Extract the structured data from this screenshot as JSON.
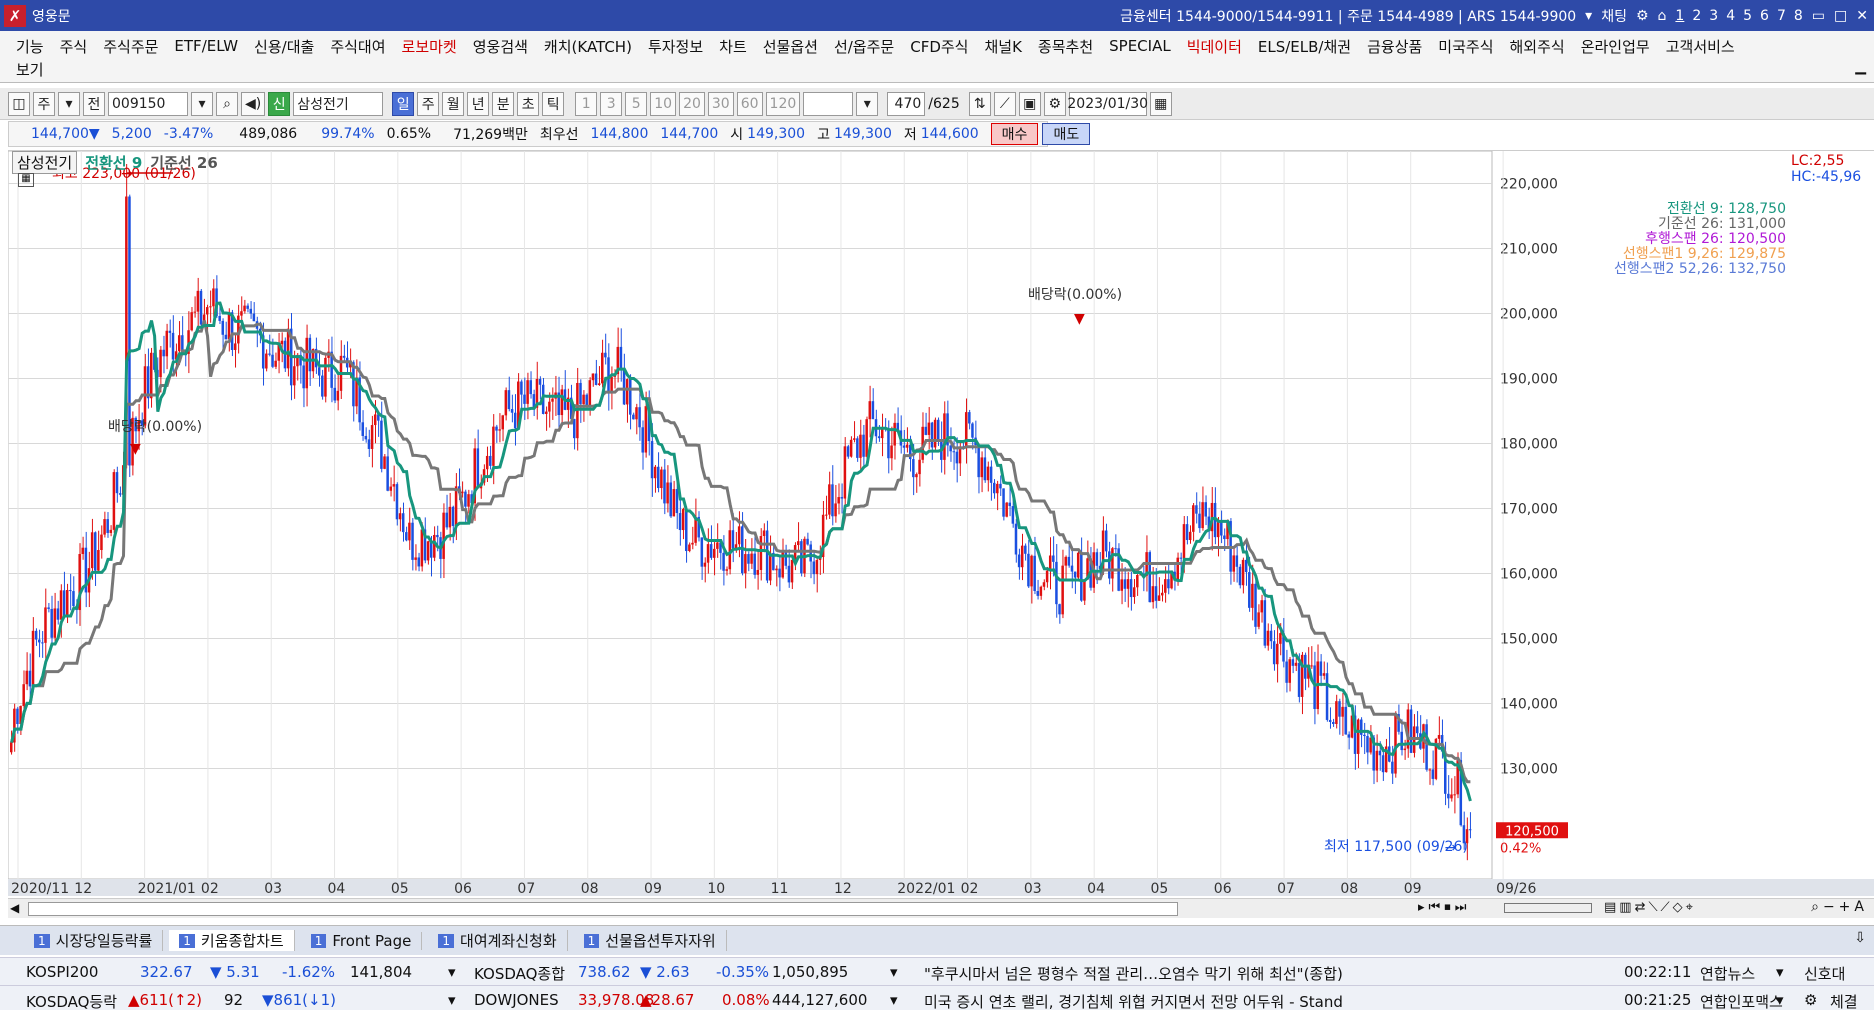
{
  "titlebar": {
    "app_name": "영웅문",
    "info": "금융센터 1544-9000/1544-9911 | 주문 1544-4989 | ARS 1544-9900",
    "chat": "채팅",
    "screens": [
      "1",
      "2",
      "3",
      "4",
      "5",
      "6",
      "7",
      "8"
    ]
  },
  "menu": {
    "items": [
      "기능",
      "주식",
      "주식주문",
      "ETF/ELW",
      "신용/대출",
      "주식대여",
      "로보마켓",
      "영웅검색",
      "캐치(KATCH)",
      "투자정보",
      "차트",
      "선물옵션",
      "선/옵주문",
      "CFD주식",
      "채널K",
      "종목추천",
      "SPECIAL",
      "빅데이터",
      "ELS/ELB/채권",
      "금융상품",
      "미국주식",
      "해외주식",
      "온라인업무",
      "고객서비스"
    ],
    "red_items": [
      "로보마켓",
      "빅데이터"
    ],
    "second_line": "보기"
  },
  "toolbar": {
    "mode1": "주",
    "mode2": "전",
    "code": "009150",
    "credit_badge": "신",
    "name": "삼성전기",
    "periods": [
      "일",
      "주",
      "월",
      "년",
      "분",
      "초",
      "틱"
    ],
    "active_period": "일",
    "intervals": [
      "1",
      "3",
      "5",
      "10",
      "20",
      "30",
      "60",
      "120"
    ],
    "count": "470",
    "total": "/625",
    "date": "2023/01/30"
  },
  "quote": {
    "price": "144,700▼",
    "change": "5,200",
    "rate": "-3.47%",
    "volume": "489,086",
    "vol_ratio": "99.74%",
    "turnover_rate": "0.65%",
    "amount": "71,269백만",
    "best_label": "최우선",
    "best_ask": "144,800",
    "best_bid": "144,700",
    "open_label": "시",
    "open": "149,300",
    "high_label": "고",
    "high": "149,300",
    "low_label": "저",
    "low": "144,600",
    "buy": "매수",
    "sell": "매도"
  },
  "chart": {
    "stock": "삼성전기",
    "ind1": "전환선 9",
    "ind2": "기준선 26",
    "max_label": "최고 223,000 (01/26)",
    "min_label": "최저 117,500 (09/26)",
    "dividend1": "배당락(0.00%)",
    "dividend2": "배당락(0.00%)",
    "lc": "LC:2,55",
    "hc": "HC:-45,96",
    "right_legend": [
      {
        "text": "전환선 9: 128,750",
        "color": "#17967e"
      },
      {
        "text": "기준선 26: 131,000",
        "color": "#666666"
      },
      {
        "text": "후행스팬 26: 120,500",
        "color": "#b01ad6"
      },
      {
        "text": "선행스팬1 9,26: 129,875",
        "color": "#f0a050"
      },
      {
        "text": "선행스팬2 52,26: 132,750",
        "color": "#5a7ad6"
      }
    ],
    "last_price": "120,500",
    "last_rate": "0.42%",
    "y_ticks": [
      "220,000",
      "210,000",
      "200,000",
      "190,000",
      "180,000",
      "170,000",
      "160,000",
      "150,000",
      "140,000",
      "130,000"
    ],
    "x_ticks": [
      "2020/11",
      "12",
      "2021/01",
      "02",
      "03",
      "04",
      "05",
      "06",
      "07",
      "08",
      "09",
      "10",
      "11",
      "12",
      "2022/01",
      "02",
      "03",
      "04",
      "05",
      "06",
      "07",
      "08",
      "09",
      "09/26"
    ]
  },
  "chart_data": {
    "type": "candlestick",
    "title": "삼성전기",
    "x": [
      "2020/11",
      "12",
      "2021/01",
      "02",
      "03",
      "04",
      "05",
      "06",
      "07",
      "08",
      "09",
      "10",
      "11",
      "12",
      "2022/01",
      "02",
      "03",
      "04",
      "05",
      "06",
      "07",
      "08",
      "09"
    ],
    "ylim": [
      113000,
      225000
    ],
    "series": [
      {
        "name": "전환선 9",
        "color": "#17967e"
      },
      {
        "name": "기준선 26",
        "color": "#777777"
      }
    ],
    "approx_monthly_close": [
      137000,
      160000,
      185000,
      205000,
      190000,
      195000,
      163000,
      177000,
      186000,
      190000,
      172000,
      160000,
      165000,
      180000,
      183000,
      170000,
      157000,
      162000,
      166000,
      155000,
      133000,
      138000,
      120500
    ],
    "max": {
      "value": 223000,
      "date": "01/26"
    },
    "min": {
      "value": 117500,
      "date": "09/26"
    }
  },
  "status_tabs": [
    {
      "num": "1",
      "label": "시장당일등락률"
    },
    {
      "num": "1",
      "label": "키움종합차트"
    },
    {
      "num": "1",
      "label": "Front Page"
    },
    {
      "num": "1",
      "label": "대여계좌신청화"
    },
    {
      "num": "1",
      "label": "선물옵션투자자위"
    }
  ],
  "ticker": {
    "r1": {
      "i1": "KOSPI200",
      "v1": "322.67",
      "c1": "▼ 5.31",
      "p1": "-1.62%",
      "q1": "141,804",
      "i2": "KOSDAQ종합",
      "v2": "738.62",
      "c2": "▼ 2.63",
      "p2": "-0.35%",
      "q2": "1,050,895",
      "news": "\"후쿠시마서 넘은 평형수 적절 관리…오염수 막기 위해 최선\"(종합)",
      "time": "00:22:11",
      "src": "연합뉴스",
      "right": "신호대"
    },
    "r2": {
      "i1": "KOSDAQ등락",
      "v1": "▲611(↑2)",
      "c1": "92",
      "p1": "▼861(↓1)",
      "i2": "DOWJONES",
      "v2": "33,978.08",
      "c2": "▲28.67",
      "p2": "0.08%",
      "q2": "444,127,600",
      "news": "미국 증시 연초 랠리, 경기침체 위협 커지면서 전망 어두워 - Stand",
      "time": "00:21:25",
      "src": "연합인포맥스",
      "right": "체결"
    }
  }
}
